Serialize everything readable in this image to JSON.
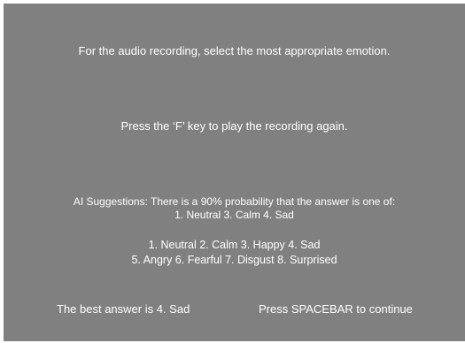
{
  "colors": {
    "background": "#808080",
    "text": "#ffffff"
  },
  "prompt": {
    "instruction": "For the audio recording, select the most appropriate emotion.",
    "replay_hint": "Press the ‘F’ key to play the recording again."
  },
  "ai_suggestion": {
    "line1": "AI Suggestions: There is a 90% probability that the answer is one of:",
    "line2": "1. Neutral  3. Calm  4. Sad"
  },
  "options": {
    "row1": "1. Neutral  2. Calm  3. Happy  4. Sad",
    "row2": "5. Angry  6. Fearful  7. Disgust  8. Surprised"
  },
  "footer": {
    "best_answer": "The best answer is 4. Sad",
    "continue_hint": "Press SPACEBAR to continue"
  }
}
